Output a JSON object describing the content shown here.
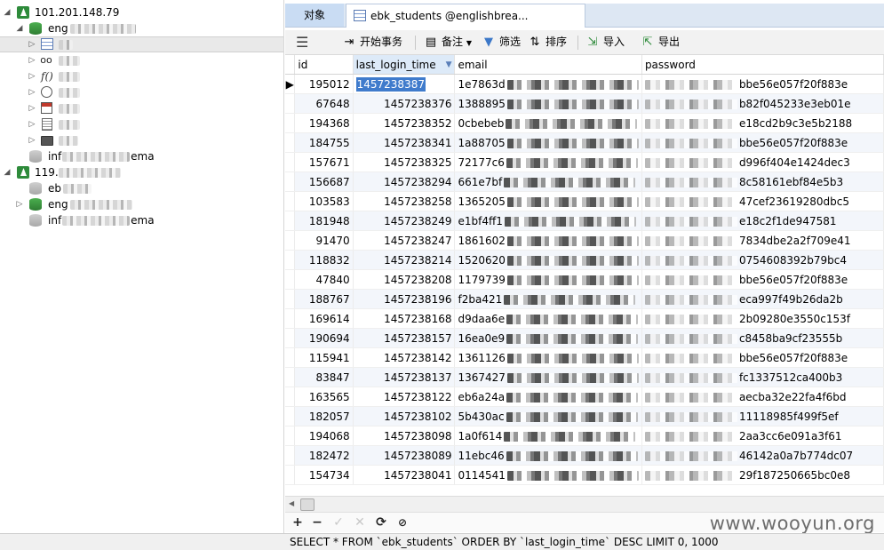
{
  "nav": {
    "connections": [
      {
        "host": "101.201.148.79"
      },
      {
        "host": "119."
      }
    ],
    "db_english_prefix": "eng",
    "db_information_prefix": "inf",
    "db_information_suffix": "ema",
    "db_eb_prefix": "eb",
    "node_icons": [
      "server-icon",
      "database-icon",
      "table-icon",
      "view-icon",
      "function-icon",
      "event-icon",
      "query-icon",
      "report-icon",
      "backup-icon"
    ]
  },
  "tabs": {
    "objects": "对象",
    "table_tab": "ebk_students @englishbrea..."
  },
  "toolbar": {
    "begin_transaction": "开始事务",
    "memo": "备注",
    "filter": "筛选",
    "sort": "排序",
    "import": "导入",
    "export": "导出"
  },
  "grid": {
    "columns": [
      "id",
      "last_login_time",
      "email",
      "password"
    ],
    "sorted_column": "last_login_time",
    "sort_direction": "desc",
    "rows": [
      {
        "id": "195012",
        "last_login_time": "1457238387",
        "email": "1e7863d",
        "password": "bbe56e057f20f883e"
      },
      {
        "id": "67648",
        "last_login_time": "1457238376",
        "email": "1388895",
        "password": "b82f045233e3eb01e"
      },
      {
        "id": "194368",
        "last_login_time": "1457238352",
        "email": "0cbebeb",
        "password": "e18cd2b9c3e5b2188"
      },
      {
        "id": "184755",
        "last_login_time": "1457238341",
        "email": "1a88705",
        "password": "bbe56e057f20f883e"
      },
      {
        "id": "157671",
        "last_login_time": "1457238325",
        "email": "72177c6",
        "password": "d996f404e1424dec3"
      },
      {
        "id": "156687",
        "last_login_time": "1457238294",
        "email": "661e7bf",
        "password": "8c58161ebf84e5b3"
      },
      {
        "id": "103583",
        "last_login_time": "1457238258",
        "email": "1365205",
        "password": "47cef23619280dbc5"
      },
      {
        "id": "181948",
        "last_login_time": "1457238249",
        "email": "e1bf4ff1",
        "password": "e18c2f1de947581"
      },
      {
        "id": "91470",
        "last_login_time": "1457238247",
        "email": "1861602",
        "password": "7834dbe2a2f709e41"
      },
      {
        "id": "118832",
        "last_login_time": "1457238214",
        "email": "1520620",
        "password": "0754608392b79bc4"
      },
      {
        "id": "47840",
        "last_login_time": "1457238208",
        "email": "1179739",
        "password": "bbe56e057f20f883e"
      },
      {
        "id": "188767",
        "last_login_time": "1457238196",
        "email": "f2ba421",
        "password": "eca997f49b26da2b"
      },
      {
        "id": "169614",
        "last_login_time": "1457238168",
        "email": "d9daa6e",
        "password": "2b09280e3550c153f"
      },
      {
        "id": "190694",
        "last_login_time": "1457238157",
        "email": "16ea0e9",
        "password": "c8458ba9cf23555b"
      },
      {
        "id": "115941",
        "last_login_time": "1457238142",
        "email": "1361126",
        "password": "bbe56e057f20f883e"
      },
      {
        "id": "83847",
        "last_login_time": "1457238137",
        "email": "1367427",
        "password": "fc1337512ca400b3"
      },
      {
        "id": "163565",
        "last_login_time": "1457238122",
        "email": "eb6a24a",
        "password": "aecba32e22fa4f6bd"
      },
      {
        "id": "182057",
        "last_login_time": "1457238102",
        "email": "5b430ac",
        "password": "11118985f499f5ef"
      },
      {
        "id": "194068",
        "last_login_time": "1457238098",
        "email": "1a0f614",
        "password": "2aa3cc6e091a3f61"
      },
      {
        "id": "182472",
        "last_login_time": "1457238089",
        "email": "11ebc46",
        "password": "46142a0a7b774dc07"
      },
      {
        "id": "154734",
        "last_login_time": "1457238041",
        "email": "0114541",
        "password": "29f187250665bc0e8"
      }
    ]
  },
  "recordbar": {
    "add": "+",
    "delete": "−",
    "apply": "✓",
    "discard": "✕",
    "refresh": "⟳",
    "stop": "⊘"
  },
  "watermark": "www.wooyun.org",
  "status": {
    "sql": "SELECT * FROM `ebk_students` ORDER BY `last_login_time` DESC LIMIT 0, 1000"
  }
}
